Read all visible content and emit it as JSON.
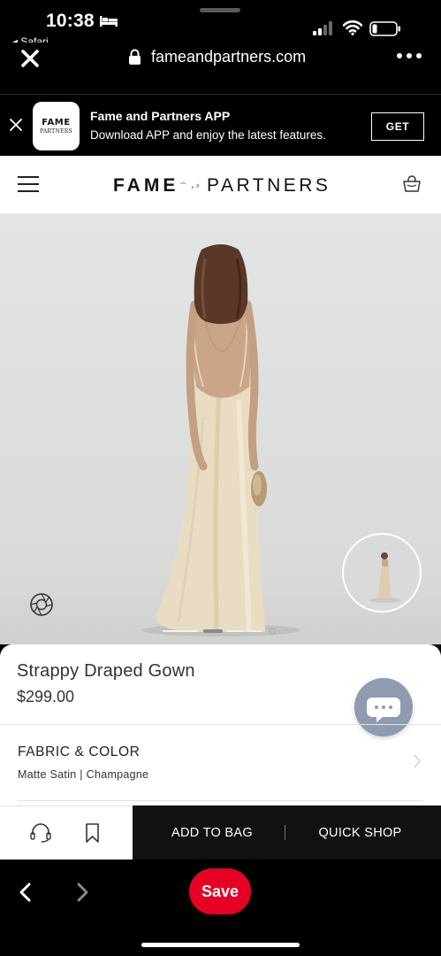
{
  "status_bar": {
    "time": "10:38",
    "back_app": "◂ Safari",
    "icons": [
      "bed-icon",
      "signal-icon",
      "wifi-icon",
      "battery-icon"
    ]
  },
  "browser": {
    "url": "fameandpartners.com",
    "icons": [
      "close-icon",
      "lock-icon",
      "more-icon"
    ]
  },
  "app_banner": {
    "logo_line1": "FAME",
    "logo_line2": "PARTNERS",
    "title": "Fame and Partners APP",
    "subtitle": "Download APP and enjoy the latest features.",
    "get_label": "GET"
  },
  "header": {
    "brand_left": "FAME",
    "brand_amp": "AND",
    "brand_right": "PARTNERS",
    "icons": [
      "menu-icon",
      "bag-icon"
    ]
  },
  "gallery": {
    "image": "model-back-view-champagne-gown",
    "icons": [
      "ar-view-icon",
      "thumbnail-image",
      "carousel-dots"
    ]
  },
  "product": {
    "name": "Strappy Draped Gown",
    "price": "$299.00",
    "fabric_label": "FABRIC & COLOR",
    "fabric_value": "Matte Satin | Champagne"
  },
  "actions": {
    "add_to_bag": "ADD TO BAG",
    "quick_shop": "QUICK SHOP",
    "icons": [
      "support-icon",
      "bookmark-icon"
    ]
  },
  "bottom_bar": {
    "save_label": "Save",
    "icons": [
      "back-icon",
      "forward-icon"
    ]
  },
  "colors": {
    "save_red": "#e60023",
    "chat_bubble": "#8e9bb0",
    "gown": "#e9dcc3"
  }
}
